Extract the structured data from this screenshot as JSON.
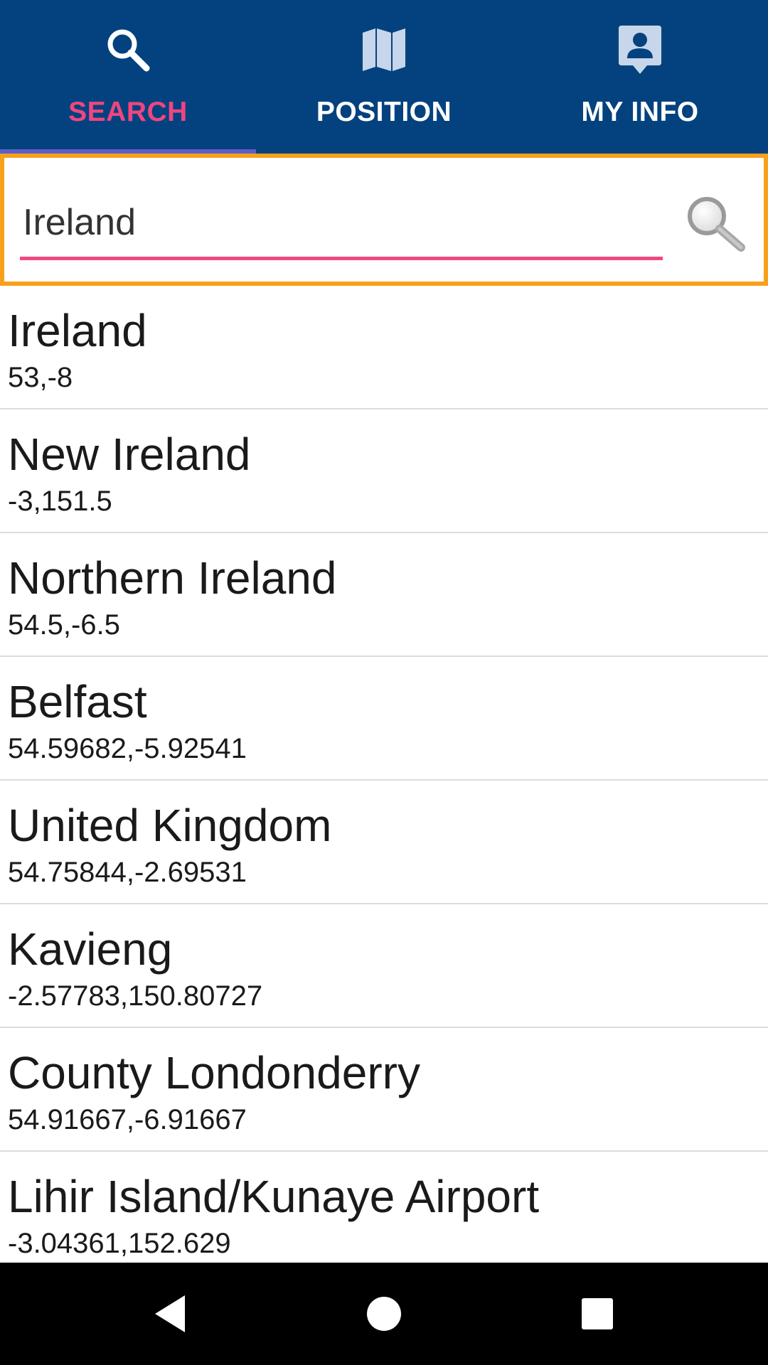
{
  "tabs": [
    {
      "label": "SEARCH",
      "icon": "search-icon",
      "active": true
    },
    {
      "label": "POSITION",
      "icon": "map-icon",
      "active": false
    },
    {
      "label": "MY INFO",
      "icon": "contact-icon",
      "active": false
    }
  ],
  "colors": {
    "tabbar_bg": "#04427f",
    "active_tab_text": "#f0457f",
    "tab_indicator": "#5b60c8",
    "search_border": "#f7a11a",
    "input_underline": "#ee4a7f",
    "navbar_bg": "#000000"
  },
  "search": {
    "value": "Ireland"
  },
  "results": [
    {
      "name": "Ireland",
      "coords": "53,-8"
    },
    {
      "name": "New Ireland",
      "coords": "-3,151.5"
    },
    {
      "name": "Northern Ireland",
      "coords": "54.5,-6.5"
    },
    {
      "name": "Belfast",
      "coords": "54.59682,-5.92541"
    },
    {
      "name": "United Kingdom",
      "coords": "54.75844,-2.69531"
    },
    {
      "name": "Kavieng",
      "coords": "-2.57783,150.80727"
    },
    {
      "name": "County Londonderry",
      "coords": "54.91667,-6.91667"
    },
    {
      "name": "Lihir Island/Kunaye Airport",
      "coords": "-3.04361,152.629"
    }
  ],
  "navbar": {
    "buttons": [
      "back-icon",
      "home-icon",
      "recents-icon"
    ]
  }
}
